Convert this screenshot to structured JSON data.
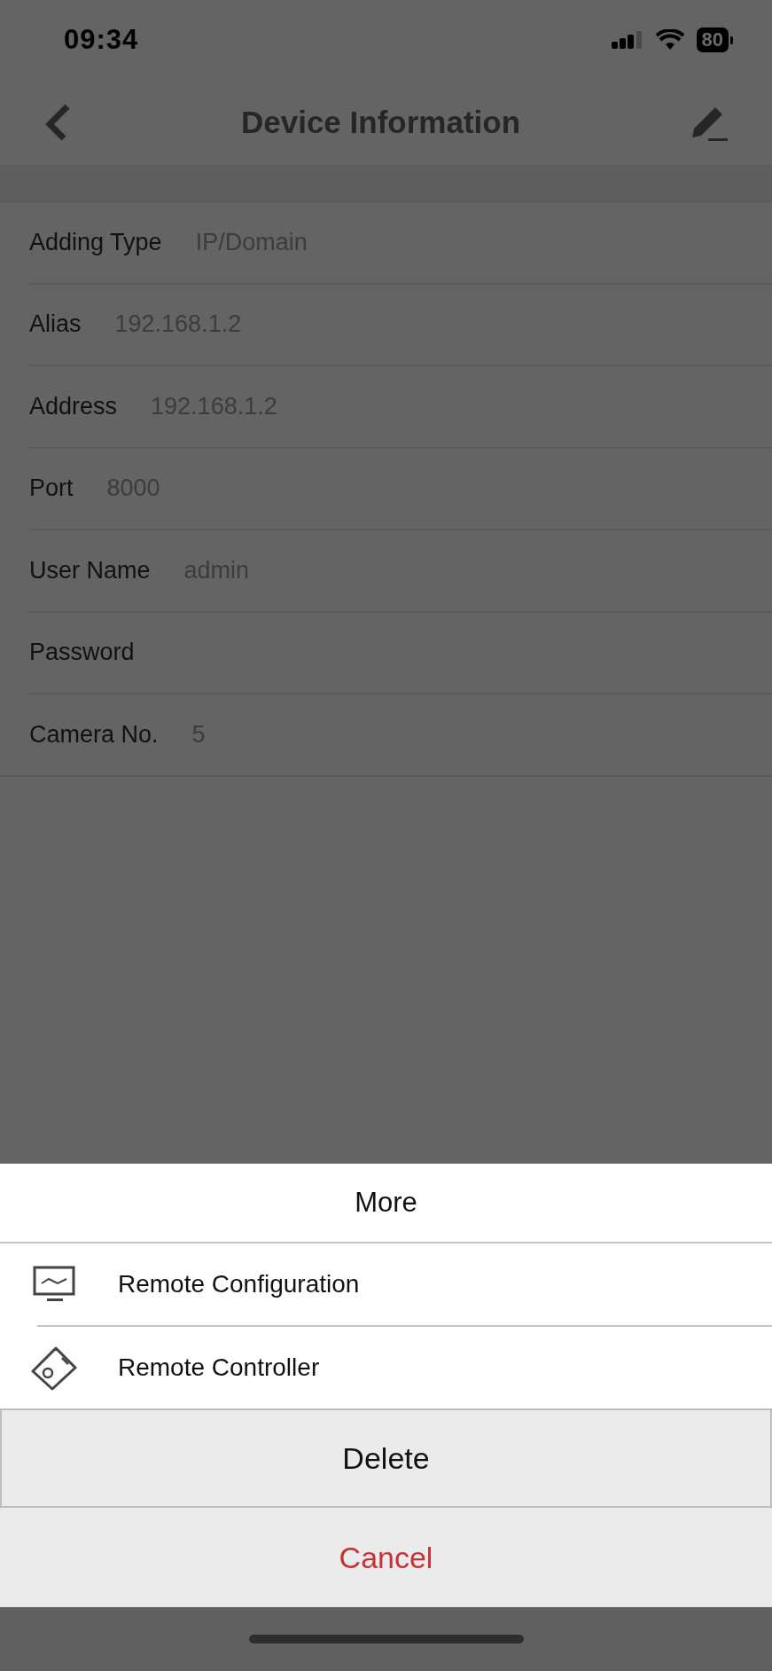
{
  "status_bar": {
    "time": "09:34",
    "battery": "80"
  },
  "nav_bar": {
    "title": "Device Information"
  },
  "fields": [
    {
      "label": "Adding Type",
      "value": "IP/Domain"
    },
    {
      "label": "Alias",
      "value": "192.168.1.2"
    },
    {
      "label": "Address",
      "value": "192.168.1.2"
    },
    {
      "label": "Port",
      "value": "8000"
    },
    {
      "label": "User Name",
      "value": "admin"
    },
    {
      "label": "Password"
    },
    {
      "label": "Camera No.",
      "value": "5"
    }
  ],
  "action_sheet": {
    "title": "More",
    "items": [
      {
        "label": "Remote Configuration",
        "kind": "monitor"
      },
      {
        "label": "Remote Controller",
        "kind": "remote"
      }
    ],
    "delete": "Delete",
    "cancel": "Cancel"
  }
}
